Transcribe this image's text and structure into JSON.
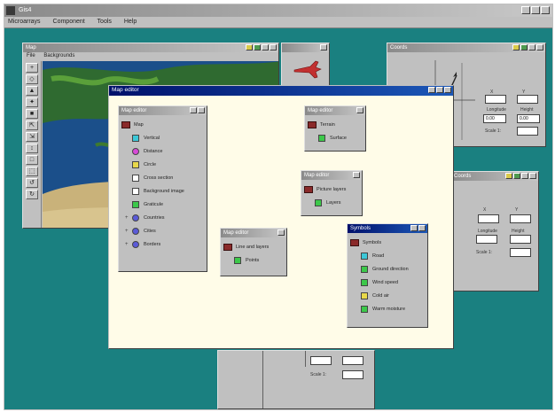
{
  "app": {
    "title": "Gis4",
    "menu": [
      "Microarrays",
      "Component",
      "Tools",
      "Help"
    ]
  },
  "map_window": {
    "title": "Map",
    "menu": [
      "File",
      "Backgrounds"
    ],
    "tools": [
      "+",
      "◇",
      "▲",
      "✦",
      "■",
      "⇱",
      "⇲",
      "↕",
      "□",
      "⬚",
      "↺",
      "↻"
    ]
  },
  "dialog": {
    "title": "Map editor"
  },
  "main_tree": {
    "title": "Map editor",
    "root": "Map",
    "items": [
      {
        "label": "Vertical",
        "color": "#3cc8d8"
      },
      {
        "label": "Distance",
        "color": "#d84ad8"
      },
      {
        "label": "Circle",
        "color": "#e8d84a"
      },
      {
        "label": "Cross section",
        "color": "#ffffff"
      },
      {
        "label": "Background image",
        "color": "#ffffff"
      },
      {
        "label": "Graticule",
        "color": "#3cc84a"
      },
      {
        "label": "Countries",
        "color": "#5a5ad8"
      },
      {
        "label": "Cities",
        "color": "#5a5ad8"
      },
      {
        "label": "Borders",
        "color": "#5a5ad8"
      }
    ]
  },
  "mini1": {
    "title": "Map editor",
    "root": "Terrain",
    "child": "Surface"
  },
  "mini2": {
    "title": "Map editor",
    "root": "Picture layers",
    "child": "Layers"
  },
  "mini3": {
    "title": "Map editor",
    "root": "Line and layers",
    "child": "Points"
  },
  "mini4": {
    "title": "Symbols",
    "root": "Symbols",
    "items": [
      {
        "label": "Road",
        "color": "#3cc8d8"
      },
      {
        "label": "Ground direction",
        "color": "#3cc84a"
      },
      {
        "label": "Wind speed",
        "color": "#3cc84a"
      },
      {
        "label": "Cold air",
        "color": "#e8d84a"
      },
      {
        "label": "Warm moisture",
        "color": "#3cc84a"
      }
    ]
  },
  "coords": {
    "title": "Coords",
    "labels": [
      "X",
      "Y",
      "Longitude",
      "Height",
      "Scale 1:"
    ],
    "values": [
      "0.00",
      "0.00"
    ]
  },
  "coords2": {
    "title": "Coords",
    "labels": [
      "X",
      "Y",
      "Longitude",
      "Height",
      "Scale 1:"
    ]
  },
  "bottom_panel": {
    "label": "Scale 1:"
  }
}
